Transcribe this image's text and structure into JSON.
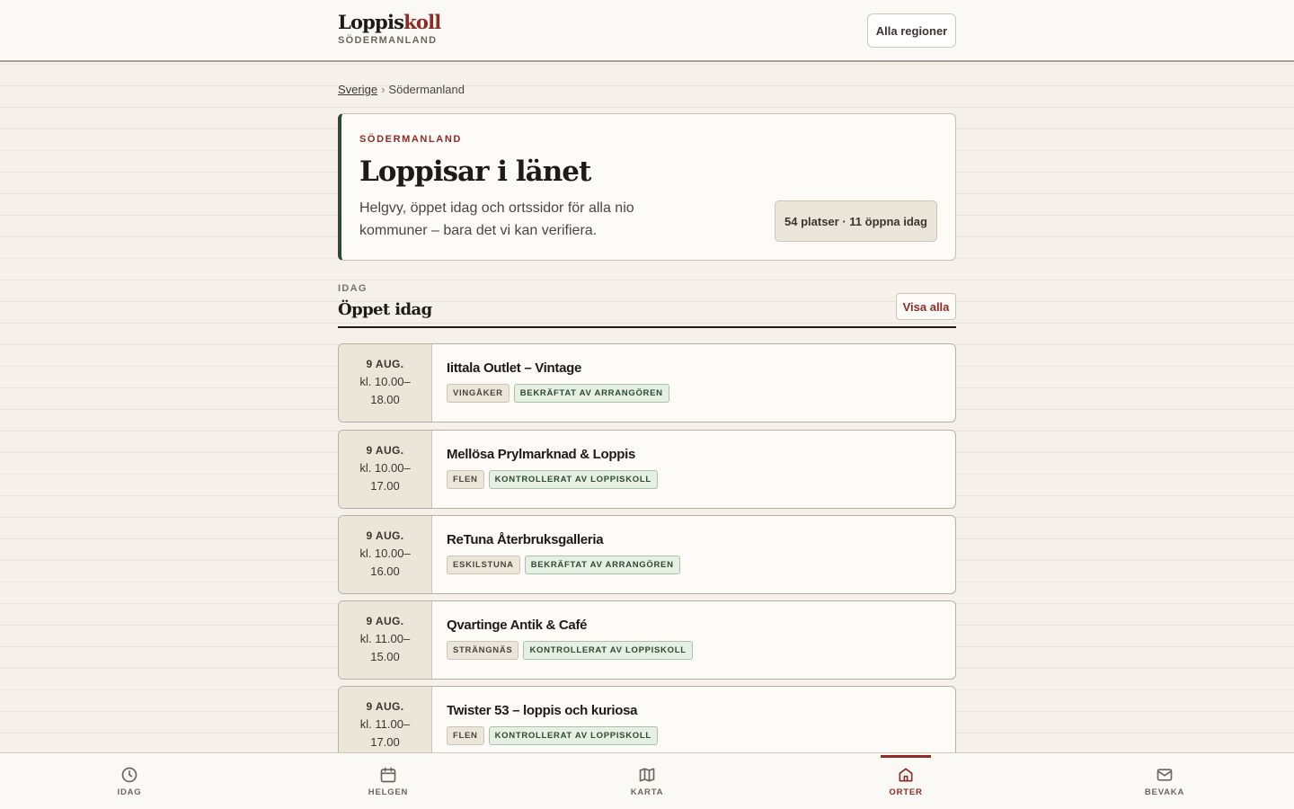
{
  "header": {
    "brand_main": "Loppis",
    "brand_accent": "koll",
    "region": "SÖDERMANLAND",
    "region_button": "Alla regioner"
  },
  "breadcrumb": {
    "root": "Sverige",
    "separator": "›",
    "current": "Södermanland"
  },
  "hero": {
    "eyebrow": "SÖDERMANLAND",
    "title": "Loppisar i länet",
    "description": "Helgvy, öppet idag och ortssidor för alla nio kommuner – bara det vi kan verifiera.",
    "stat": "54 platser · 11 öppna idag"
  },
  "section": {
    "eyebrow": "IDAG",
    "title": "Öppet idag",
    "see_all": "Visa alla"
  },
  "markets": [
    {
      "date": "9 AUG.",
      "time": "kl. 10.00–18.00",
      "name": "Iittala Outlet – Vintage",
      "town": "VINGÅKER",
      "status": "BEKRÄFTAT AV ARRANGÖREN"
    },
    {
      "date": "9 AUG.",
      "time": "kl. 10.00–17.00",
      "name": "Mellösa Prylmarknad & Loppis",
      "town": "FLEN",
      "status": "KONTROLLERAT AV LOPPISKOLL"
    },
    {
      "date": "9 AUG.",
      "time": "kl. 10.00–16.00",
      "name": "ReTuna Återbruksgalleria",
      "town": "ESKILSTUNA",
      "status": "BEKRÄFTAT AV ARRANGÖREN"
    },
    {
      "date": "9 AUG.",
      "time": "kl. 11.00–15.00",
      "name": "Qvartinge Antik & Café",
      "town": "STRÄNGNÄS",
      "status": "KONTROLLERAT AV LOPPISKOLL"
    },
    {
      "date": "9 AUG.",
      "time": "kl. 11.00–17.00",
      "name": "Twister 53 – loppis och kuriosa",
      "town": "FLEN",
      "status": "KONTROLLERAT AV LOPPISKOLL"
    }
  ],
  "nav": [
    {
      "label": "IDAG",
      "icon": "clock-icon"
    },
    {
      "label": "HELGEN",
      "icon": "calendar-icon"
    },
    {
      "label": "KARTA",
      "icon": "map-icon"
    },
    {
      "label": "ORTER",
      "icon": "home-icon",
      "active": true
    },
    {
      "label": "BEVAKA",
      "icon": "mail-icon"
    }
  ],
  "colors": {
    "accent": "#8e2b24",
    "forest": "#2f4a31",
    "background": "#f5f1ea",
    "verified_bg": "#e5efe3"
  }
}
